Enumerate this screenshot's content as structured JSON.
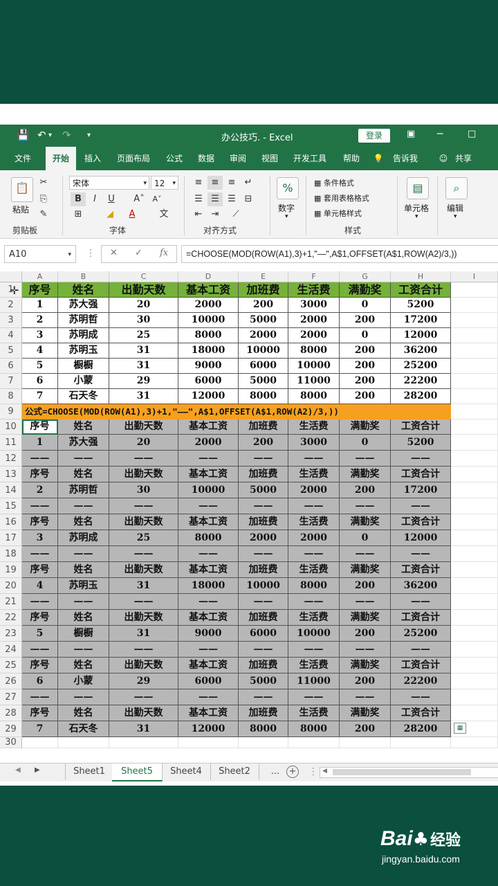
{
  "titlebar": {
    "save_icon": "save-icon",
    "undo_icon": "undo-icon",
    "redo_icon": "redo-icon",
    "title": "办公技巧. - Excel",
    "login": "登录"
  },
  "menu": [
    "文件",
    "开始",
    "插入",
    "页面布局",
    "公式",
    "数据",
    "审阅",
    "视图",
    "开发工具",
    "帮助",
    "告诉我",
    "共享"
  ],
  "ribbon": {
    "paste": "粘贴",
    "clipboard": "剪贴板",
    "font_name": "宋体",
    "font_size": "12",
    "font_group": "字体",
    "align_group": "对齐方式",
    "number": "数字",
    "cond_format": "条件格式",
    "table_format": "套用表格格式",
    "cell_style": "单元格样式",
    "styles_group": "样式",
    "cells": "单元格",
    "editing": "编辑",
    "bold": "B",
    "italic": "I",
    "underline": "U",
    "font_color": "A",
    "percent": "%"
  },
  "formula_bar": {
    "name_box": "A10",
    "fx": "fx",
    "formula": "=CHOOSE(MOD(ROW(A1),3)+1,\"—\",A$1,OFFSET(A$1,ROW(A2)/3,))"
  },
  "columns": [
    "A",
    "B",
    "C",
    "D",
    "E",
    "F",
    "G",
    "H",
    "I"
  ],
  "rows": [
    "1",
    "2",
    "3",
    "4",
    "5",
    "6",
    "7",
    "8",
    "9",
    "10",
    "11",
    "12",
    "13",
    "14",
    "15",
    "16",
    "17",
    "18",
    "19",
    "20",
    "21",
    "22",
    "23",
    "24",
    "25",
    "26",
    "27",
    "28",
    "29",
    "30"
  ],
  "headers": [
    "序号",
    "姓名",
    "出勤天数",
    "基本工资",
    "加班费",
    "生活费",
    "满勤奖",
    "工资合计"
  ],
  "gray_headers": [
    "序号",
    "姓名",
    "出勤天数",
    "基本工资",
    "加班费",
    "生活费",
    "满勤奖",
    "工资合计"
  ],
  "records": [
    [
      "1",
      "苏大强",
      "20",
      "2000",
      "200",
      "3000",
      "0",
      "5200"
    ],
    [
      "2",
      "苏明哲",
      "30",
      "10000",
      "5000",
      "2000",
      "200",
      "17200"
    ],
    [
      "3",
      "苏明成",
      "25",
      "8000",
      "2000",
      "2000",
      "0",
      "12000"
    ],
    [
      "4",
      "苏明玉",
      "31",
      "18000",
      "10000",
      "8000",
      "200",
      "36200"
    ],
    [
      "5",
      "橱橱",
      "31",
      "9000",
      "6000",
      "10000",
      "200",
      "25200"
    ],
    [
      "6",
      "小蒙",
      "29",
      "6000",
      "5000",
      "11000",
      "200",
      "22200"
    ],
    [
      "7",
      "石天冬",
      "31",
      "12000",
      "8000",
      "8000",
      "200",
      "28200"
    ]
  ],
  "dash": "——",
  "formula_note": "公式=CHOOSE(MOD(ROW(A1),3)+1,\"——\",A$1,OFFSET(A$1,ROW(A2)/3,))",
  "sheets": [
    "Sheet1",
    "Sheet5",
    "Sheet4",
    "Sheet2",
    "..."
  ],
  "active_sheet": "Sheet5",
  "watermark": {
    "brand": "Bai",
    "paw": "du",
    "cn": "经验",
    "url": "jingyan.baidu.com"
  },
  "colors": {
    "excel_green": "#217346",
    "header_green": "#76b139",
    "formula_orange": "#f6a020",
    "gray_fill": "#b7b7b7",
    "frame": "#0b4f3f"
  }
}
